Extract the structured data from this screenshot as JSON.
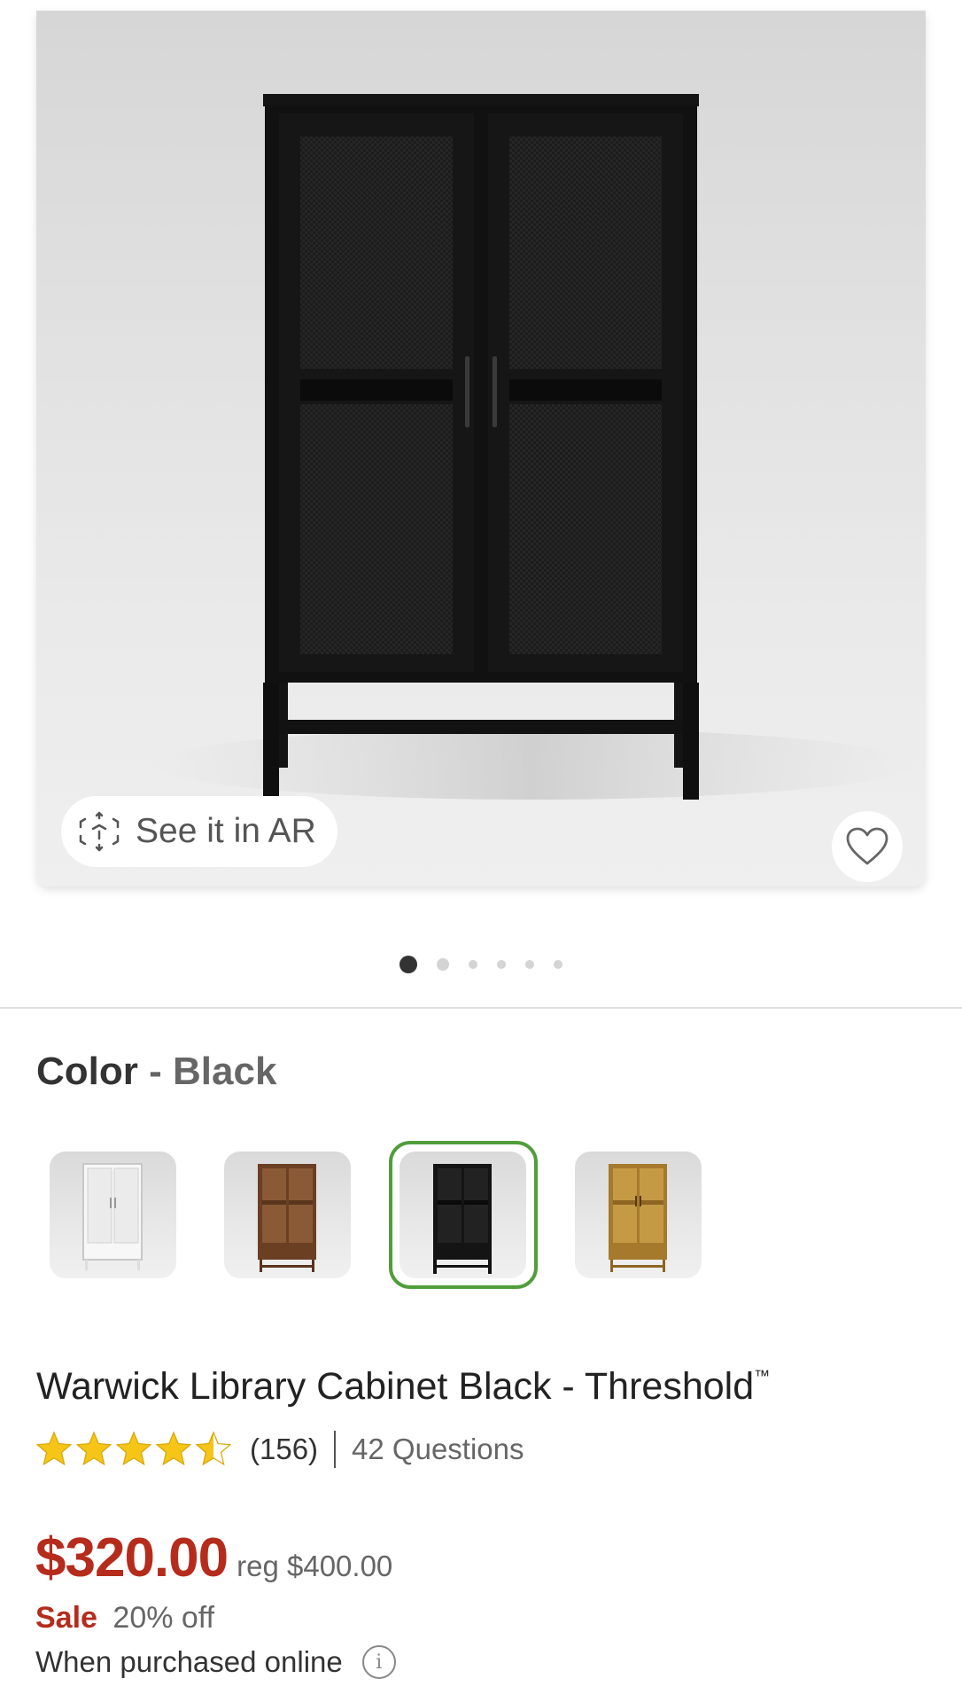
{
  "hero": {
    "ar_label": "See it in AR",
    "carousel": {
      "count": 6,
      "active_index": 0
    }
  },
  "color": {
    "label": "Color",
    "separator": "-",
    "selected": "Black",
    "swatches": [
      "White",
      "Brown",
      "Black",
      "Natural"
    ],
    "selected_index": 2
  },
  "product": {
    "title": "Warwick Library Cabinet Black - Threshold",
    "trademark": "™",
    "rating": 4.5,
    "rating_max": 5,
    "reviews_count": "(156)",
    "questions": "42 Questions"
  },
  "pricing": {
    "price": "$320.00",
    "regular": "reg $400.00",
    "sale_label": "Sale",
    "discount": "20% off",
    "note": "When purchased online"
  },
  "colors": {
    "sale_red": "#b52c1c",
    "selected_ring": "#4f9e3a",
    "star": "#f5c518"
  }
}
